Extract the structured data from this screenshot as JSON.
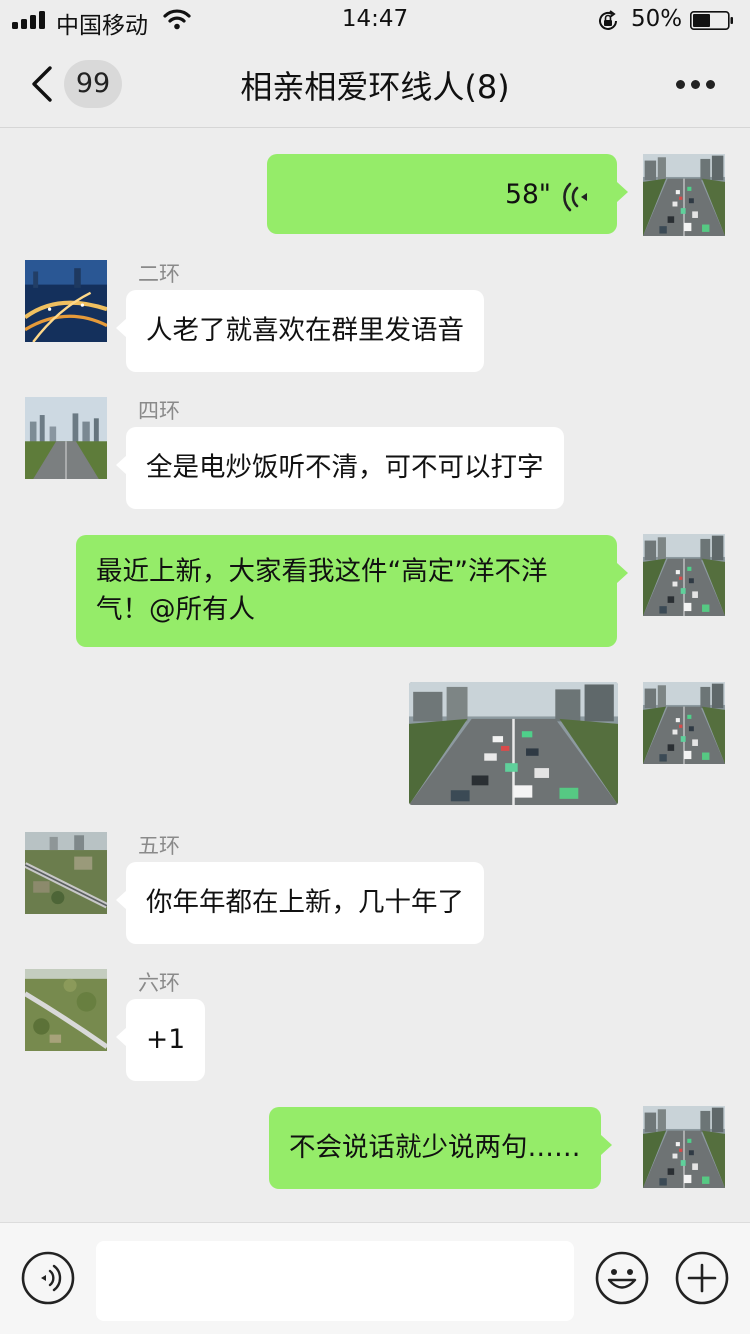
{
  "status_bar": {
    "carrier": "中国移动",
    "time": "14:47",
    "battery_percent": "50%",
    "battery_level": 0.5,
    "icons": [
      "signal-icon",
      "wifi-icon",
      "orientation-lock-icon",
      "battery-icon"
    ]
  },
  "nav": {
    "unread_count": "99",
    "title": "相亲相爱环线人(8)",
    "icons": [
      "back-chevron-icon",
      "more-dots-icon"
    ]
  },
  "messages": [
    {
      "direction": "out",
      "type": "voice",
      "duration": "58\"",
      "avatar": "self-traffic-photo"
    },
    {
      "direction": "in",
      "sender": "二环",
      "text": "人老了就喜欢在群里发语音",
      "avatar": "night-interchange-photo"
    },
    {
      "direction": "in",
      "sender": "四环",
      "text": "全是电炒饭听不清，可不可以打字",
      "avatar": "city-road-photo"
    },
    {
      "direction": "out",
      "type": "text",
      "text": "最近上新，大家看我这件“高定”洋不洋气！@所有人",
      "avatar": "self-traffic-photo"
    },
    {
      "direction": "out",
      "type": "image",
      "image": "traffic-road-photo",
      "avatar": "self-traffic-photo"
    },
    {
      "direction": "in",
      "sender": "五环",
      "text": "你年年都在上新，几十年了",
      "avatar": "aerial-ring-road-photo"
    },
    {
      "direction": "in",
      "sender": "六环",
      "text": "+1",
      "avatar": "aerial-viaduct-photo"
    },
    {
      "direction": "out",
      "type": "text",
      "text": "不会说话就少说两句……",
      "avatar": "self-traffic-photo"
    }
  ],
  "input_bar": {
    "placeholder": "",
    "icons": [
      "voice-input-icon",
      "emoji-icon",
      "plus-icon"
    ]
  },
  "colors": {
    "background": "#ededed",
    "outgoing_bubble": "#95ec69",
    "incoming_bubble": "#ffffff",
    "sender_name": "#8a8a8a"
  }
}
